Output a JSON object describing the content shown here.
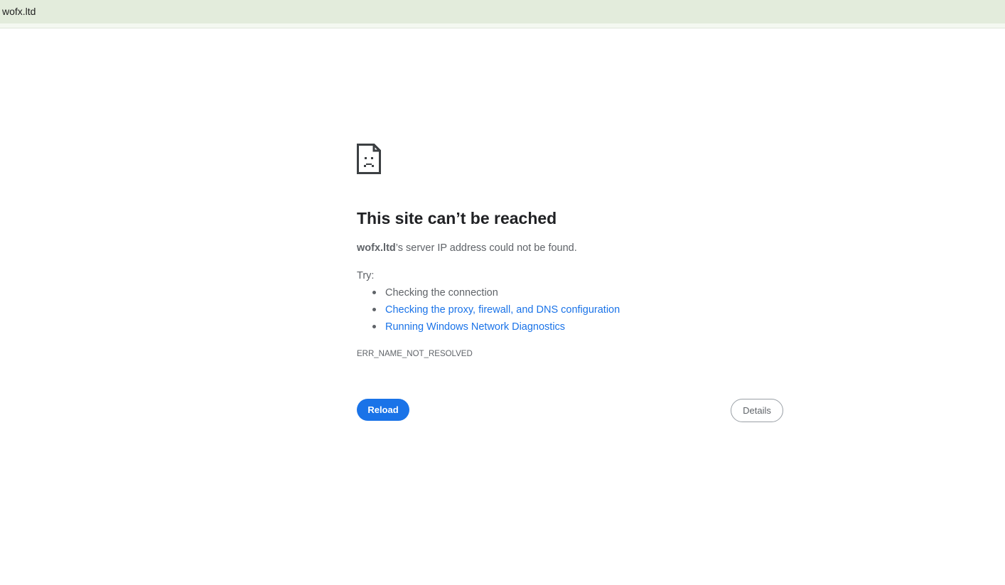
{
  "address_bar": {
    "url": "wofx.ltd"
  },
  "error_page": {
    "icon": "sad-page-icon",
    "heading": "This site can’t be reached",
    "host": "wofx.ltd",
    "summary_rest": "’s server IP address could not be found.",
    "try_label": "Try:",
    "suggestions": [
      {
        "text": "Checking the connection",
        "is_link": false
      },
      {
        "text": "Checking the proxy, firewall, and DNS configuration",
        "is_link": true
      },
      {
        "text": "Running Windows Network Diagnostics",
        "is_link": true
      }
    ],
    "error_code": "ERR_NAME_NOT_RESOLVED",
    "reload_label": "Reload",
    "details_label": "Details"
  },
  "colors": {
    "accent": "#1a73e8",
    "address_bar_bg": "#e3ecdc",
    "secondary_text": "#5f6368"
  }
}
